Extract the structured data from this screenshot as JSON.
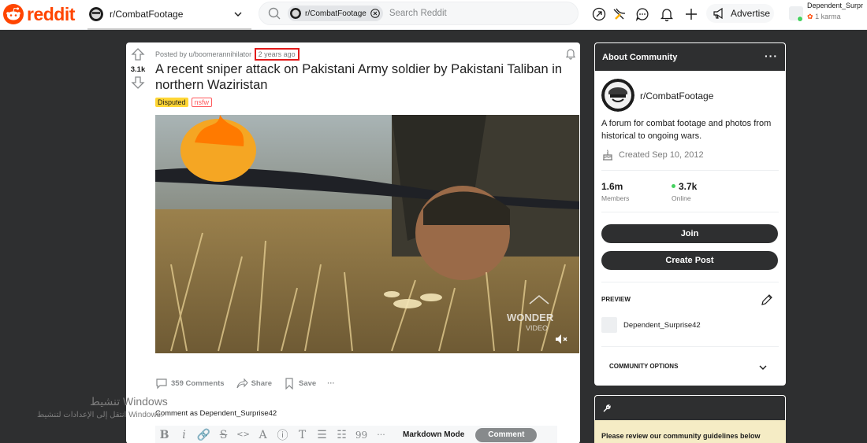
{
  "header": {
    "logo_text": "reddit",
    "current_community": "r/CombatFootage",
    "search": {
      "chip_label": "r/CombatFootage",
      "placeholder": "Search Reddit"
    },
    "advertise_label": "Advertise",
    "user": {
      "name": "Dependent_Surpr",
      "karma": "1 karma"
    },
    "icons": [
      "popular-icon",
      "coins-icon",
      "chat-icon",
      "notification-icon",
      "plus-icon"
    ]
  },
  "post": {
    "score": "3.1k",
    "posted_by": "Posted by u/boomerannihilator",
    "time_ago": "2 years ago",
    "title": "A recent sniper attack on Pakistani Army soldier by Pakistani Taliban in northern Waziristan",
    "flairs": {
      "disputed": "Disputed",
      "nsfw": "nsfw"
    },
    "video": {
      "watermark_top": "WONDER",
      "watermark_bottom": "VIDEO"
    },
    "actions": {
      "comments": "359 Comments",
      "share": "Share",
      "save": "Save",
      "more": "···"
    },
    "comment_as": "Comment as Dependent_Surprise42",
    "editor": {
      "tools": [
        "B",
        "i",
        "🔗",
        "S",
        "<>",
        "A",
        "ⓘ",
        "T",
        "☰",
        "☷",
        "99",
        "···"
      ],
      "markdown_mode": "Markdown Mode",
      "comment_button": "Comment"
    }
  },
  "windows_watermark": {
    "line1": "تنشيط Windows",
    "line2": "انتقل إلى الإعدادات لتنشيط Windows."
  },
  "about": {
    "header": "About Community",
    "menu": "···",
    "community_name": "r/CombatFootage",
    "description": "A forum for combat footage and photos from historical to ongoing wars.",
    "created": "Created Sep 10, 2012",
    "members": {
      "value": "1.6m",
      "label": "Members"
    },
    "online": {
      "value": "3.7k",
      "label": "Online"
    },
    "join_label": "Join",
    "create_post_label": "Create Post",
    "preview_label": "PREVIEW",
    "preview_user": "Dependent_Surprise42",
    "community_options": "COMMUNITY OPTIONS"
  },
  "rules": {
    "text": "Please review our community guidelines below"
  },
  "colors": {
    "brand": "#ff4500",
    "dark_header": "#2e2f30",
    "flair_disputed": "#ffd635",
    "nsfw": "#ff585b",
    "online_dot": "#46d160",
    "highlight_box": "#e21b1b"
  }
}
